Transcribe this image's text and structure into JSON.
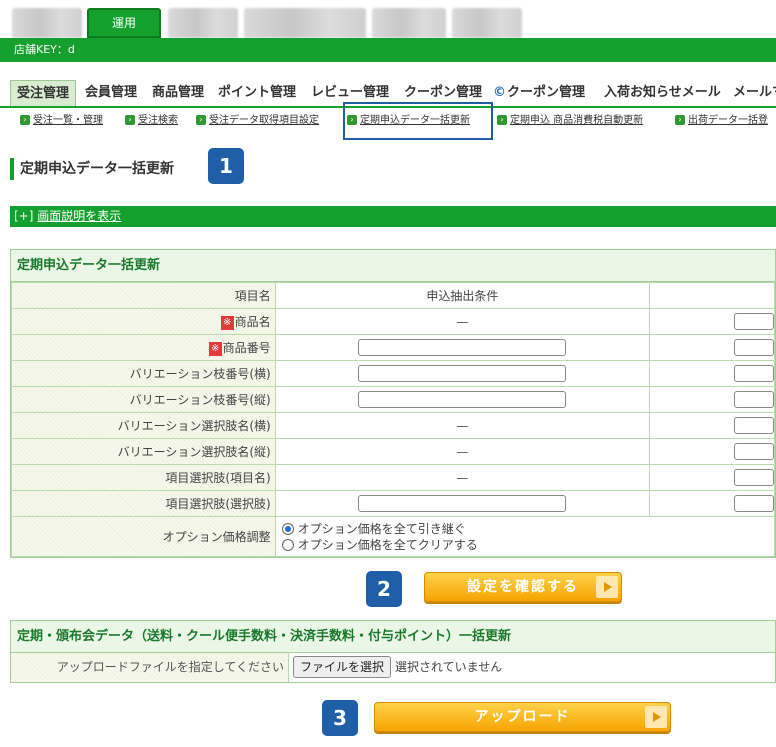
{
  "top_tabs": {
    "active_label": "運用"
  },
  "keybar": {
    "label": "店舗KEY：d"
  },
  "menu": [
    {
      "label": "受注管理",
      "active": true
    },
    {
      "label": "会員管理"
    },
    {
      "label": "商品管理"
    },
    {
      "label": "ポイント管理"
    },
    {
      "label": "レビュー管理"
    },
    {
      "label": "クーポン管理"
    },
    {
      "label": "クーポン管理",
      "icon": "c-coupon-icon"
    },
    {
      "label": "入荷お知らせメール"
    },
    {
      "label": "メールマ"
    }
  ],
  "submenu": [
    {
      "label": "受注一覧・管理"
    },
    {
      "label": "受注検索"
    },
    {
      "label": "受注データ取得項目設定"
    },
    {
      "label": "定期申込データ一括更新"
    },
    {
      "label": "定期申込 商品消費税自動更新"
    },
    {
      "label": "出荷データ一括登"
    }
  ],
  "page_title": "定期申込データ一括更新",
  "badges": [
    "1",
    "2",
    "3"
  ],
  "show_description": {
    "prefix": "[+]",
    "link": "画面説明を表示"
  },
  "bulk_panel": {
    "title": "定期申込データ一括更新",
    "headers": {
      "item": "項目名",
      "condition": "申込抽出条件"
    },
    "rows": [
      {
        "label": "商品名",
        "required": true,
        "condition": "dash"
      },
      {
        "label": "商品番号",
        "required": true,
        "condition": "input"
      },
      {
        "label": "バリエーション枝番号(横)",
        "condition": "input"
      },
      {
        "label": "バリエーション枝番号(縦)",
        "condition": "input"
      },
      {
        "label": "バリエーション選択肢名(横)",
        "condition": "dash"
      },
      {
        "label": "バリエーション選択肢名(縦)",
        "condition": "dash"
      },
      {
        "label": "項目選択肢(項目名)",
        "condition": "dash"
      },
      {
        "label": "項目選択肢(選択肢)",
        "condition": "input"
      }
    ],
    "required_mark": "※",
    "dash": "—",
    "option": {
      "label": "オプション価格調整",
      "choices": [
        {
          "label": "オプション価格を全て引き継ぐ",
          "selected": true
        },
        {
          "label": "オプション価格を全てクリアする",
          "selected": false
        }
      ]
    }
  },
  "confirm_button": "設定を確認する",
  "upload_panel": {
    "title": "定期・頒布会データ（送料・クール便手数料・決済手数料・付与ポイント）一括更新",
    "file_label": "アップロードファイルを指定してください",
    "choose_button": "ファイルを選択",
    "file_status": "選択されていません"
  },
  "upload_button": "アップロード",
  "colors": {
    "brand_green": "#14a02d",
    "highlight_blue": "#1f5fa8",
    "orange": "#f6a300",
    "required_red": "#e33b3b"
  }
}
